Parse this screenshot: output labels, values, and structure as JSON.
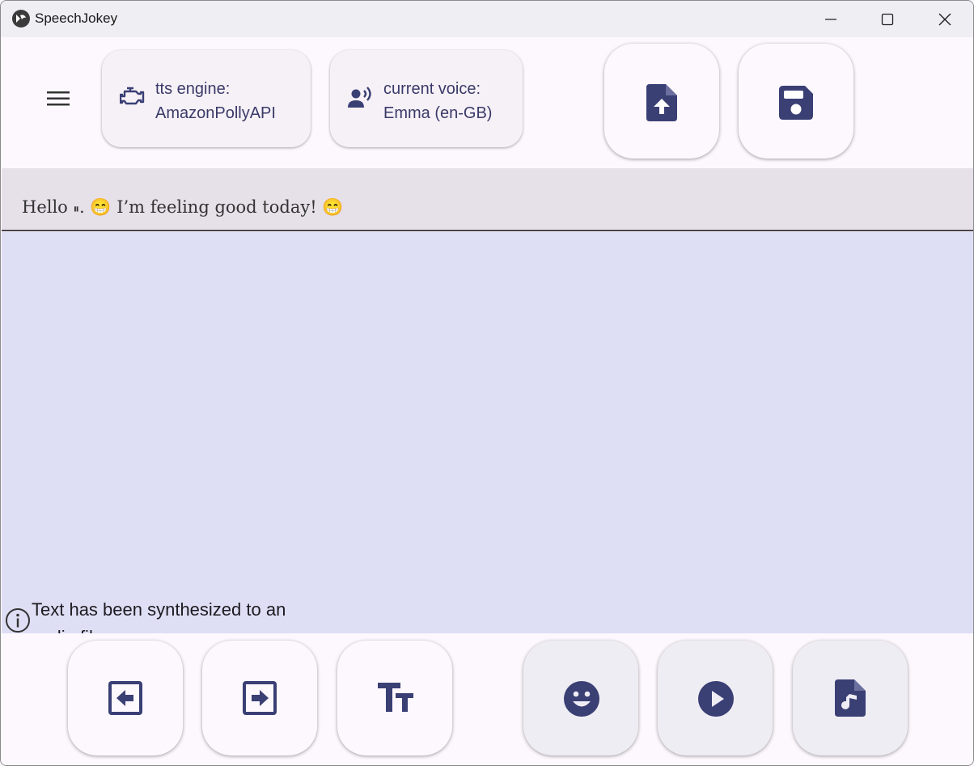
{
  "window": {
    "title": "SpeechJokey"
  },
  "toolbar": {
    "engine_label": "tts engine:",
    "engine_value": "AmazonPollyAPI",
    "voice_label": "current voice:",
    "voice_value": "Emma (en-GB)"
  },
  "editor": {
    "text_before": "Hello ",
    "pause_glyph": "⏸",
    "text_after": ". 😁 I’m feeling good today! 😁"
  },
  "status": {
    "message": "Text has been synthesized to an audio file"
  },
  "colors": {
    "accent": "#3a3f74",
    "text_field_bg": "#e6e0e9",
    "main_area_bg": "#dedef5",
    "button_bg": "#fdf8fd"
  },
  "icons": {
    "menu": "menu-icon",
    "engine": "engine-icon",
    "voice": "voice-icon",
    "upload": "file-upload-icon",
    "save": "save-icon",
    "info": "info-icon",
    "prev": "arrow-left-box-icon",
    "next": "arrow-right-box-icon",
    "text_size": "text-size-icon",
    "emoji": "smiley-icon",
    "play": "play-icon",
    "audio_file": "audio-file-icon"
  }
}
